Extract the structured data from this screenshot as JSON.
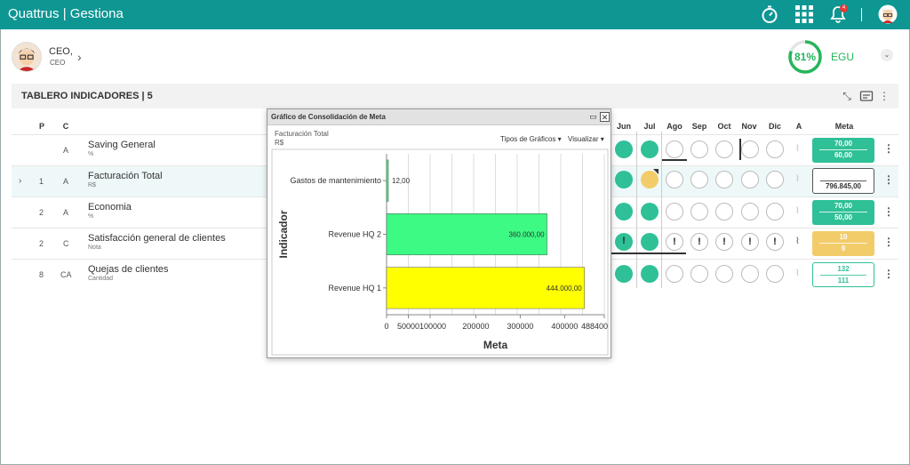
{
  "app": {
    "brand": "Quattrus",
    "module": "Gestiona",
    "notification_count": "4"
  },
  "user": {
    "name": "CEO,",
    "role": "CEO"
  },
  "gauge": {
    "value": "81%",
    "label": "EGU",
    "fraction": 0.81
  },
  "panel": {
    "title": "TABLERO INDICADORES | 5"
  },
  "columns": {
    "p": "P",
    "c": "C",
    "months": [
      "Jun",
      "Jul",
      "Ago",
      "Sep",
      "Oct",
      "Nov",
      "Dic"
    ],
    "a": "A",
    "meta": "Meta"
  },
  "rows": [
    {
      "p": "",
      "c": "A",
      "name": "Saving General",
      "unit": "%",
      "meta1": "70,00",
      "meta2": "60,00"
    },
    {
      "p": "1",
      "c": "A",
      "name": "Facturación Total",
      "unit": "R$",
      "meta1": "",
      "meta2": "796.845,00"
    },
    {
      "p": "2",
      "c": "A",
      "name": "Economia",
      "unit": "%",
      "meta1": "70,00",
      "meta2": "50,00"
    },
    {
      "p": "2",
      "c": "C",
      "name": "Satisfacción general de clientes",
      "unit": "Nota",
      "meta1": "10",
      "meta2": "9"
    },
    {
      "p": "8",
      "c": "CA",
      "name": "Quejas de clientes",
      "unit": "Cantidad",
      "meta1": "132",
      "meta2": "111"
    }
  ],
  "popup": {
    "title": "Gráfico de Consolidación de Meta",
    "indicator": "Facturación Total",
    "unit": "R$",
    "menu_chart_types": "Tipos de Gráficos",
    "menu_view": "Visualizar"
  },
  "chart_data": {
    "type": "bar",
    "orientation": "horizontal",
    "categories": [
      "Gastos de mantenimiento",
      "Revenue HQ 2",
      "Revenue HQ 1"
    ],
    "values": [
      12,
      360000,
      444000
    ],
    "data_labels": [
      "12,00",
      "360.000,00",
      "444.000,00"
    ],
    "bar_colors": [
      "#3dfa84",
      "#3dfa84",
      "#ffff00"
    ],
    "xlabel": "Meta",
    "ylabel": "Indicador",
    "xlim": [
      0,
      488400
    ],
    "x_ticks": [
      0,
      50000,
      100000,
      200000,
      300000,
      400000,
      488400
    ],
    "x_tick_labels": [
      "0",
      "50000",
      "100000",
      "200000",
      "300000",
      "400000",
      "488400"
    ],
    "grid": true
  },
  "colors": {
    "topbar": "#0e9693",
    "green": "#2fc098",
    "yellow": "#f3cc6a"
  }
}
